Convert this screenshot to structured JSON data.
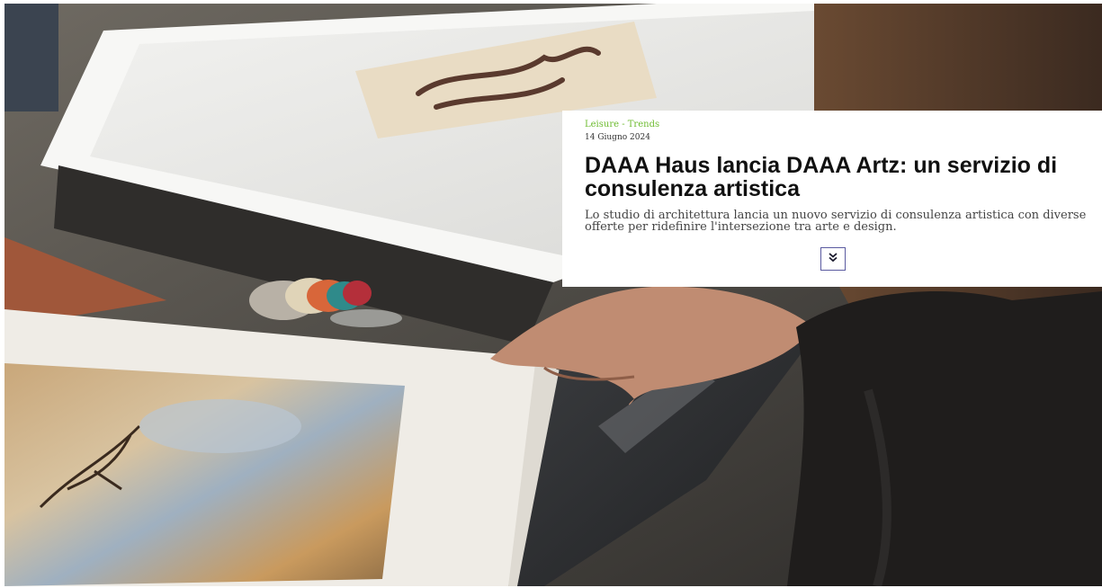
{
  "article": {
    "category": "Leisure - Trends",
    "date": "14 Giugno 2024",
    "title": "DAAA Haus lancia DAAA Artz: un servizio di consulenza artistica",
    "summary": "Lo studio di architettura lancia un nuovo servizio di consulenza artistica con diverse offerte per ridefinire l'intersezione tra arte e design.",
    "expand_icon": "double-chevron-down-icon"
  },
  "colors": {
    "category": "#6dbb2f",
    "title": "#111111",
    "summary": "#444444",
    "button_border": "#5a5aa0"
  }
}
